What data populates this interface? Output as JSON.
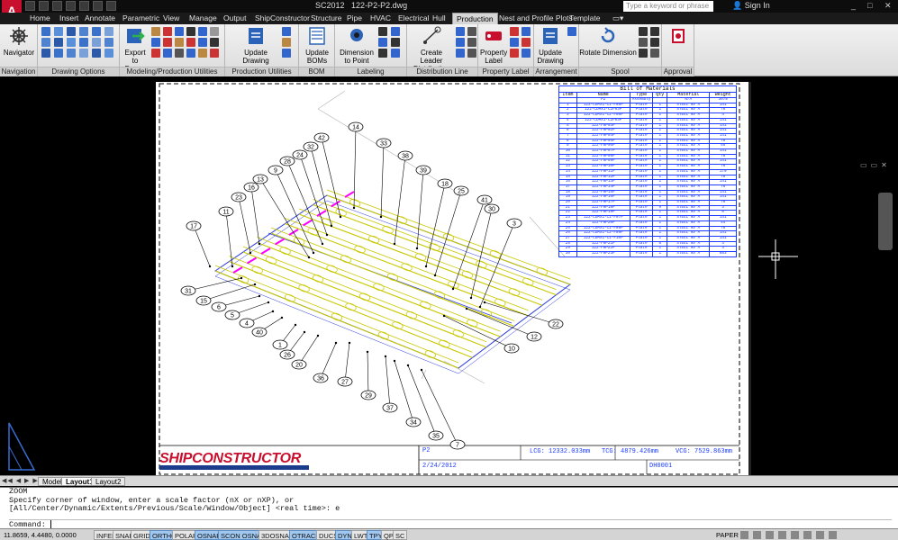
{
  "title_bar": {
    "app_logo": "A",
    "app_name": "SC2012",
    "document": "122-P2-P2.dwg",
    "search_placeholder": "Type a keyword or phrase",
    "sign_in": "Sign In",
    "window_buttons": [
      "_",
      "□",
      "✕"
    ]
  },
  "ribbon_tabs": [
    "Home",
    "Insert",
    "Annotate",
    "Parametric",
    "View",
    "Manage",
    "Output",
    "ShipConstructor",
    "Structure",
    "Pipe",
    "HVAC",
    "Electrical",
    "Hull",
    "Production",
    "Nest and Profile Plots",
    "Template"
  ],
  "active_tab": "Production",
  "ribbon": {
    "navigation": {
      "button": "Navigator",
      "title": "Navigation"
    },
    "drawing_options": {
      "title": "Drawing Options"
    },
    "modeling": {
      "button": "Export to Dwg...",
      "title": "Modeling/Production Utilities"
    },
    "production_utilities": {
      "button": "Update Drawing",
      "title": "Production Utilities"
    },
    "bom": {
      "button": "Update BOMs",
      "title": "BOM"
    },
    "labeling": {
      "button": "Dimension to Point",
      "title": "Labeling"
    },
    "distribution": {
      "button": "Create Leader Distribution Line",
      "title": "Distribution Line"
    },
    "property_label": {
      "button": "Property Label",
      "title": "Property Label"
    },
    "arrangement": {
      "button": "Update Drawing",
      "title": "Arrangement"
    },
    "spool": {
      "button": "Rotate Dimension",
      "title": "Spool"
    },
    "approval": {
      "title": "Approval"
    }
  },
  "bom": {
    "title": "Bill of Materials",
    "headers": [
      "Item",
      "Name",
      "Type",
      "Qty",
      "Material",
      "Weight"
    ],
    "rows": [
      [
        "",
        "P2",
        "Assembly",
        "",
        "N/A",
        "3078"
      ],
      [
        "1",
        "122-CDMX1-C1-F08P",
        "Plate",
        "1",
        "STEEL NV A",
        "141"
      ],
      [
        "2",
        "122-CDMX1-C2F03P",
        "Plate",
        "1",
        "STEEL NV A",
        "76"
      ],
      [
        "3",
        "122-CDMX1-C2-F08P",
        "Plate",
        "1",
        "STEEL NV A",
        "4"
      ],
      [
        "4",
        "122-CDMX1-C2F03P",
        "Plate",
        "1",
        "STEEL NV A",
        "141"
      ],
      [
        "5",
        "122-F0P03P",
        "Plate",
        "1",
        "STEEL NV A",
        "141"
      ],
      [
        "6",
        "122-F0P02P",
        "Plate",
        "1",
        "STEEL NV A",
        "141"
      ],
      [
        "7",
        "122-F0P04P",
        "Plate",
        "1",
        "STEEL NV A",
        "141"
      ],
      [
        "8",
        "122-F0P05P",
        "Plate",
        "1",
        "STEEL NV A",
        "76"
      ],
      [
        "9",
        "122-F0P06P",
        "Plate",
        "1",
        "STEEL NV A",
        "55"
      ],
      [
        "10",
        "122-F0P07P",
        "Plate",
        "1",
        "STEEL NV A",
        "141"
      ],
      [
        "11",
        "122-F0P08P",
        "Plate",
        "1",
        "STEEL NV A",
        "76"
      ],
      [
        "12",
        "122-F0P09P",
        "Plate",
        "1",
        "STEEL NV A",
        "141"
      ],
      [
        "13",
        "122-F0P10P",
        "Plate",
        "1",
        "STEEL NV A",
        "76"
      ],
      [
        "14",
        "122-F0P11P",
        "Plate",
        "1",
        "STEEL NV A",
        "170"
      ],
      [
        "15",
        "122-F0P12P",
        "Plate",
        "1",
        "STEEL NV A",
        "76"
      ],
      [
        "16",
        "122-F0P13P",
        "Plate",
        "1",
        "STEEL NV A",
        "141"
      ],
      [
        "17",
        "122-F0P14P",
        "Plate",
        "1",
        "STEEL NV A",
        "76"
      ],
      [
        "18",
        "122-F0P15P",
        "Plate",
        "1",
        "STEEL NV A",
        "141"
      ],
      [
        "19",
        "122-F0P16P",
        "Plate",
        "1",
        "STEEL NV A",
        "141"
      ],
      [
        "20",
        "122-F0P17P",
        "Plate",
        "1",
        "STEEL NV A",
        "76"
      ],
      [
        "21",
        "122-F0P18P",
        "Plate",
        "9",
        "STEEL NV A",
        "3"
      ],
      [
        "22",
        "122-F0P19P",
        "Plate",
        "1",
        "STEEL NV A",
        "6"
      ],
      [
        "23",
        "122-CDMX1-C1-F07P",
        "Plate",
        "1",
        "STEEL NV A",
        "141"
      ],
      [
        "24",
        "122-F0P20P",
        "Plate",
        "1",
        "STEEL NV A",
        "44"
      ],
      [
        "25",
        "122-CDMX1-C1-F09P",
        "Plate",
        "1",
        "STEEL NV A",
        "76"
      ],
      [
        "26",
        "122-CDMX1-C2-F09P",
        "Plate",
        "1",
        "STEEL NV A",
        "141"
      ],
      [
        "27",
        "122-CDMX1-C1-F10P",
        "Plate",
        "1",
        "STEEL NV A",
        "141"
      ],
      [
        "28",
        "122-F0P21P",
        "Plate",
        "8",
        "STEEL NV A",
        "3"
      ],
      [
        "29",
        "122-F0P22P",
        "Plate",
        "1",
        "STEEL NV A",
        "3"
      ],
      [
        "30",
        "122-F0P23P",
        "Plate",
        "1",
        "STEEL NV A",
        "883"
      ]
    ]
  },
  "balloons": [
    "14",
    "42",
    "33",
    "32",
    "24",
    "38",
    "28",
    "9",
    "39",
    "18",
    "13",
    "25",
    "16",
    "41",
    "23",
    "11",
    "30",
    "3",
    "17",
    "31",
    "15",
    "6",
    "5",
    "4",
    "40",
    "1",
    "26",
    "20",
    "36",
    "27",
    "29",
    "37",
    "34",
    "35",
    "7",
    "10",
    "12",
    "22"
  ],
  "title_block": {
    "logo": "SHIPCONSTRUCTOR",
    "name": "P2",
    "date": "2/24/2012",
    "lcg": "LCG: 12332.033mm",
    "tcg": "TCG: 4879.426mm",
    "vcg": "VCG: 7529.863mm",
    "drawing_no": "DH0001"
  },
  "layout_tabs": [
    "Model",
    "Layout1",
    "Layout2"
  ],
  "active_layout": "Layout1",
  "command": {
    "history": [
      "ZOOM",
      "Specify corner of window, enter a scale factor (nX or nXP), or",
      "[All/Center/Dynamic/Extents/Previous/Scale/Window/Object] <real time>: e"
    ],
    "prompt": "Command:"
  },
  "status": {
    "coords": "11.8659, 4.4480, 0.0000",
    "toggles": [
      "INFER",
      "SNAP",
      "GRID",
      "ORTHO",
      "POLAR",
      "OSNAP",
      "3DOSNAP",
      "OTRACK",
      "DUCS",
      "DYN",
      "LWT",
      "TPY",
      "QP",
      "SC"
    ],
    "toggles_on": [
      "ORTHO",
      "OSNAP",
      "SCON OSNAP",
      "OTRACK",
      "DYN",
      "TPY"
    ],
    "paper": "PAPER",
    "scon_osnap": "SCON OSNAP"
  },
  "colors": {
    "accent": "#c8102e",
    "drawing_blue": "#1a3aff",
    "weld_magenta": "#ff00ff",
    "hole_yellow": "#c8c800"
  }
}
